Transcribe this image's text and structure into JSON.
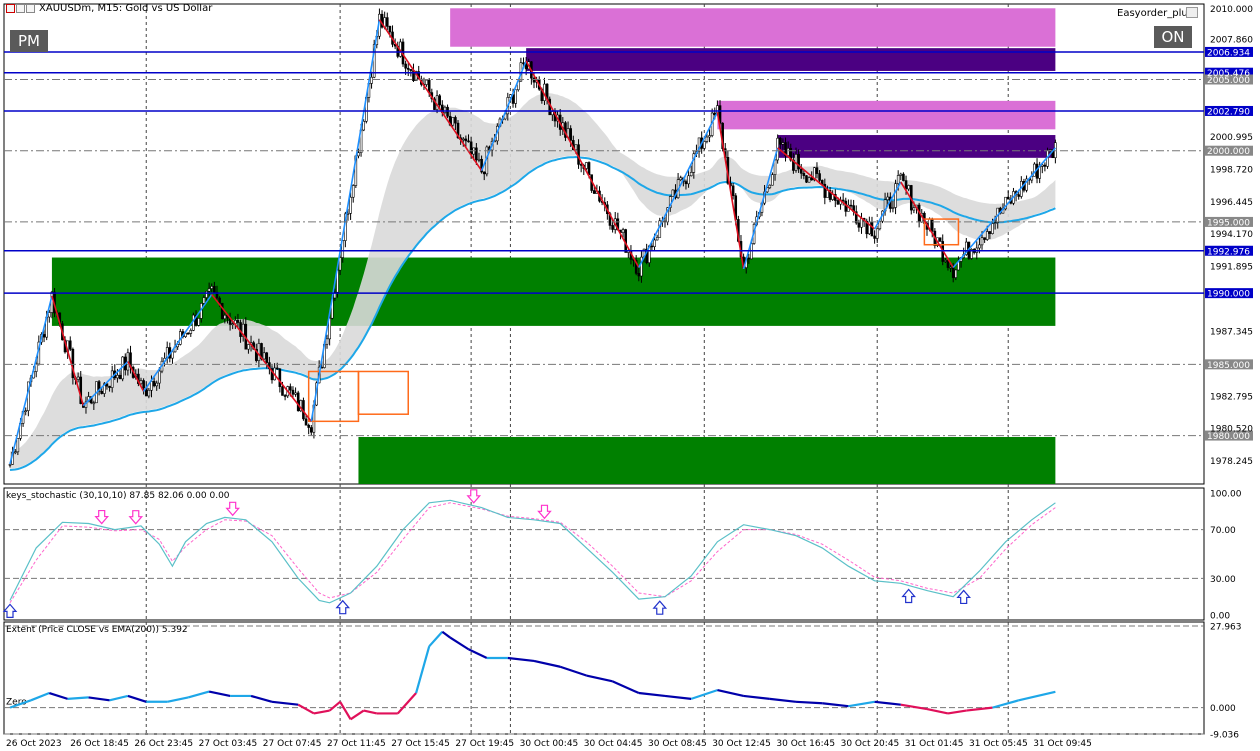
{
  "window": {
    "symbol_title": "XAUUSDm, M15:  Gold vs US Dollar",
    "pm_button": "PM",
    "on_button": "ON",
    "easyorder_label": "Easyorder_plus"
  },
  "colors": {
    "background": "#ffffff",
    "bull_candle": "#000000",
    "zone_pink": "#da70d6",
    "zone_purple": "#4b0082",
    "zone_green": "#008000",
    "zone_green_light": "#4fb34f",
    "ema_cloud": "#d9d9d9",
    "ema_line": "#1ea7e8",
    "zigzag_up": "#1e90ff",
    "zigzag_down": "#e01020",
    "hline_blue": "#0000c8",
    "stoch_main": "#5bc0c8",
    "stoch_signal": "#ff66cc",
    "extent_up": "#1ea7e8",
    "extent_dn": "#0000aa",
    "extent_neg": "#e0105a"
  },
  "chart_data": [
    {
      "type": "candlestick",
      "title": "XAUUSDm, M15:  Gold vs US Dollar",
      "y_ticks": [
        "2010.000",
        "2007.860",
        "2006.934",
        "2005.476",
        "2005.000",
        "2002.790",
        "2000.995",
        "2000.000",
        "1998.720",
        "1996.445",
        "1995.000",
        "1994.170",
        "1992.976",
        "1991.895",
        "1990.000",
        "1987.345",
        "1985.000",
        "1982.795",
        "1980.520",
        "1980.000",
        "1978.245"
      ],
      "ylim": [
        1976.6,
        2010.3
      ],
      "x_ticks": [
        "26 Oct 2023",
        "26 Oct 18:45",
        "26 Oct 23:45",
        "27 Oct 03:45",
        "27 Oct 07:45",
        "27 Oct 11:45",
        "27 Oct 15:45",
        "27 Oct 19:45",
        "30 Oct 00:45",
        "30 Oct 04:45",
        "30 Oct 08:45",
        "30 Oct 12:45",
        "30 Oct 16:45",
        "30 Oct 20:45",
        "31 Oct 01:45",
        "31 Oct 05:45",
        "31 Oct 09:45"
      ],
      "key_levels": [
        {
          "price": 2006.934,
          "label": "2006.934",
          "style": "blue-solid"
        },
        {
          "price": 2005.476,
          "label": "2005.476",
          "style": "blue-solid"
        },
        {
          "price": 2005.0,
          "label": "2005.000",
          "style": "dashdot"
        },
        {
          "price": 2002.79,
          "label": "2002.790",
          "style": "blue-solid"
        },
        {
          "price": 2000.0,
          "label": "2000.000",
          "style": "dashdot"
        },
        {
          "price": 1995.0,
          "label": "1995.000",
          "style": "dashdot"
        },
        {
          "price": 1992.976,
          "label": "1992.976",
          "style": "blue-solid"
        },
        {
          "price": 1990.0,
          "label": "1990.000",
          "style": "blue-solid"
        },
        {
          "price": 1985.0,
          "label": "1985.000",
          "style": "dashdot"
        },
        {
          "price": 1980.0,
          "label": "1980.000",
          "style": "dashdot"
        }
      ],
      "zones": [
        {
          "color": "pink",
          "from_bar": 168,
          "to_bar": 399,
          "high": 2010.0,
          "low": 2007.3
        },
        {
          "color": "purple",
          "from_bar": 197,
          "to_bar": 399,
          "high": 2007.2,
          "low": 2005.6
        },
        {
          "color": "pink",
          "from_bar": 270,
          "to_bar": 399,
          "high": 2003.5,
          "low": 2001.5
        },
        {
          "color": "purple",
          "from_bar": 293,
          "to_bar": 399,
          "high": 2001.1,
          "low": 1999.5
        },
        {
          "color": "green",
          "from_bar": 16,
          "to_bar": 399,
          "high": 1992.5,
          "low": 1987.7
        },
        {
          "color": "green",
          "from_bar": 133,
          "to_bar": 399,
          "high": 1979.9,
          "low": 1976.6
        }
      ],
      "zigzag": [
        [
          0,
          1978
        ],
        [
          16,
          1989.8
        ],
        [
          28,
          1982.1
        ],
        [
          45,
          1985.2
        ],
        [
          51,
          1983.1
        ],
        [
          77,
          1989.9
        ],
        [
          115,
          1981
        ],
        [
          141,
          2009.2
        ],
        [
          180,
          1998.6
        ],
        [
          197,
          2006.3
        ],
        [
          240,
          1991.8
        ],
        [
          270,
          2002.7
        ],
        [
          280,
          1991.7
        ],
        [
          293,
          2000.2
        ],
        [
          330,
          1994.5
        ],
        [
          340,
          1997.8
        ],
        [
          360,
          1991.8
        ],
        [
          399,
          2000.2
        ]
      ],
      "vertical_grid_bars": [
        52,
        126,
        176,
        191,
        265,
        331,
        381
      ]
    },
    {
      "type": "line",
      "title": "keys_stochastic (30,10,10) 87.85 82.06 0.00 0.00",
      "y_ticks": [
        "100.00",
        "70.00",
        "30.00",
        "0.00"
      ],
      "ylim": [
        0,
        100
      ],
      "main": [
        [
          0,
          12
        ],
        [
          10,
          55
        ],
        [
          20,
          76
        ],
        [
          30,
          75
        ],
        [
          40,
          70
        ],
        [
          50,
          73
        ],
        [
          57,
          58
        ],
        [
          62,
          40
        ],
        [
          67,
          60
        ],
        [
          75,
          75
        ],
        [
          82,
          80
        ],
        [
          90,
          78
        ],
        [
          100,
          60
        ],
        [
          110,
          30
        ],
        [
          118,
          12
        ],
        [
          122,
          10
        ],
        [
          130,
          18
        ],
        [
          140,
          40
        ],
        [
          150,
          70
        ],
        [
          160,
          92
        ],
        [
          168,
          94
        ],
        [
          180,
          88
        ],
        [
          190,
          80
        ],
        [
          200,
          78
        ],
        [
          210,
          75
        ],
        [
          220,
          55
        ],
        [
          230,
          35
        ],
        [
          240,
          13
        ],
        [
          250,
          15
        ],
        [
          260,
          32
        ],
        [
          270,
          60
        ],
        [
          280,
          74
        ],
        [
          290,
          70
        ],
        [
          300,
          65
        ],
        [
          310,
          55
        ],
        [
          320,
          40
        ],
        [
          330,
          28
        ],
        [
          340,
          26
        ],
        [
          350,
          20
        ],
        [
          360,
          15
        ],
        [
          370,
          36
        ],
        [
          380,
          60
        ],
        [
          390,
          78
        ],
        [
          399,
          92
        ]
      ],
      "signal": [
        [
          0,
          10
        ],
        [
          10,
          45
        ],
        [
          20,
          73
        ],
        [
          30,
          72
        ],
        [
          40,
          69
        ],
        [
          50,
          70
        ],
        [
          57,
          62
        ],
        [
          62,
          44
        ],
        [
          67,
          56
        ],
        [
          75,
          70
        ],
        [
          82,
          78
        ],
        [
          90,
          77
        ],
        [
          100,
          65
        ],
        [
          110,
          38
        ],
        [
          118,
          18
        ],
        [
          122,
          14
        ],
        [
          130,
          18
        ],
        [
          140,
          35
        ],
        [
          150,
          62
        ],
        [
          160,
          88
        ],
        [
          168,
          92
        ],
        [
          180,
          87
        ],
        [
          190,
          81
        ],
        [
          200,
          79
        ],
        [
          210,
          76
        ],
        [
          220,
          60
        ],
        [
          230,
          40
        ],
        [
          240,
          18
        ],
        [
          250,
          15
        ],
        [
          260,
          28
        ],
        [
          270,
          52
        ],
        [
          280,
          70
        ],
        [
          290,
          70
        ],
        [
          300,
          66
        ],
        [
          310,
          58
        ],
        [
          320,
          45
        ],
        [
          330,
          31
        ],
        [
          340,
          28
        ],
        [
          350,
          22
        ],
        [
          360,
          18
        ],
        [
          370,
          30
        ],
        [
          380,
          54
        ],
        [
          390,
          74
        ],
        [
          399,
          88
        ]
      ],
      "down_arrows": [
        35,
        48,
        85,
        177,
        204
      ],
      "up_arrows": [
        0,
        127,
        248,
        343,
        364
      ]
    },
    {
      "type": "line",
      "title": "Extent (Price CLOSE vs EMA(200)) 5.392",
      "y_ticks": [
        "27.963",
        "0.000",
        "-9.036"
      ],
      "zero_label": "Zero",
      "ylim": [
        -9.036,
        27.963
      ],
      "values": [
        [
          0,
          0
        ],
        [
          8,
          2.5
        ],
        [
          15,
          5
        ],
        [
          22,
          3
        ],
        [
          30,
          3.5
        ],
        [
          38,
          2.5
        ],
        [
          45,
          4
        ],
        [
          52,
          2
        ],
        [
          60,
          2
        ],
        [
          68,
          3.5
        ],
        [
          76,
          5.5
        ],
        [
          84,
          4
        ],
        [
          92,
          4
        ],
        [
          100,
          2
        ],
        [
          110,
          1
        ],
        [
          116,
          -2
        ],
        [
          122,
          -1
        ],
        [
          126,
          2
        ],
        [
          130,
          -4
        ],
        [
          135,
          -1
        ],
        [
          140,
          -2
        ],
        [
          148,
          -2
        ],
        [
          155,
          5
        ],
        [
          160,
          21
        ],
        [
          165,
          26
        ],
        [
          168,
          24
        ],
        [
          175,
          20
        ],
        [
          182,
          17
        ],
        [
          190,
          17
        ],
        [
          200,
          16
        ],
        [
          210,
          14
        ],
        [
          220,
          11
        ],
        [
          230,
          9
        ],
        [
          240,
          5
        ],
        [
          250,
          4
        ],
        [
          260,
          3
        ],
        [
          270,
          6
        ],
        [
          280,
          4
        ],
        [
          290,
          3
        ],
        [
          300,
          2
        ],
        [
          310,
          1.5
        ],
        [
          320,
          0.5
        ],
        [
          330,
          2
        ],
        [
          340,
          1
        ],
        [
          350,
          -0.5
        ],
        [
          358,
          -2
        ],
        [
          365,
          -1
        ],
        [
          375,
          0
        ],
        [
          385,
          2.5
        ],
        [
          399,
          5.4
        ]
      ]
    }
  ]
}
